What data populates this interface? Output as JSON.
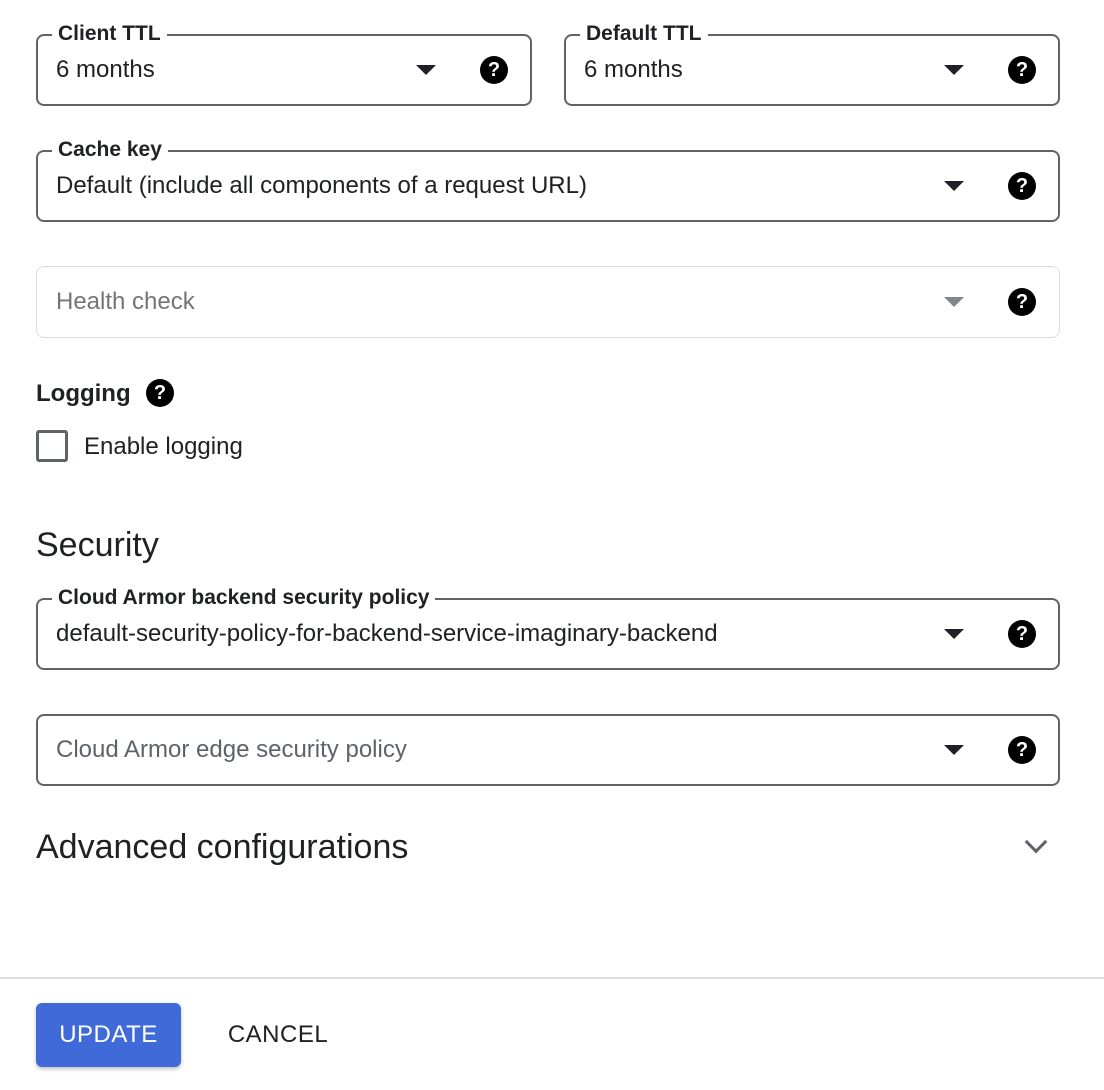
{
  "cache": {
    "client_ttl": {
      "label": "Client TTL",
      "value": "6 months",
      "help": "?"
    },
    "default_ttl": {
      "label": "Default TTL",
      "value": "6 months",
      "help": "?"
    },
    "cache_key": {
      "label": "Cache key",
      "value": "Default (include all components of a request URL)",
      "help": "?"
    }
  },
  "health_check": {
    "placeholder": "Health check",
    "help": "?"
  },
  "logging": {
    "label": "Logging",
    "help": "?",
    "enable_label": "Enable logging",
    "enabled": false
  },
  "security": {
    "heading": "Security",
    "backend_policy": {
      "label": "Cloud Armor backend security policy",
      "value": "default-security-policy-for-backend-service-imaginary-backend",
      "help": "?"
    },
    "edge_policy": {
      "placeholder": "Cloud Armor edge security policy",
      "help": "?"
    }
  },
  "advanced": {
    "heading": "Advanced configurations",
    "expanded": false
  },
  "footer": {
    "update_label": "UPDATE",
    "cancel_label": "CANCEL"
  },
  "colors": {
    "primary_button": "#3f6ad8",
    "border": "#5f6368",
    "divider": "#dadce0"
  }
}
